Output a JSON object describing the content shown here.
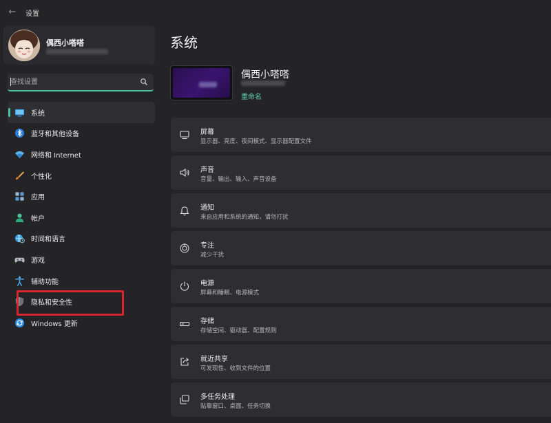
{
  "window": {
    "title": "设置",
    "back_glyph": "←"
  },
  "profile": {
    "name": "偶西小嗒嗒"
  },
  "search": {
    "placeholder": "查找设置"
  },
  "sidebar": {
    "items": [
      {
        "label": "系统",
        "icon": "monitor-icon",
        "active": true
      },
      {
        "label": "蓝牙和其他设备",
        "icon": "bluetooth-icon"
      },
      {
        "label": "网络和 Internet",
        "icon": "wifi-icon"
      },
      {
        "label": "个性化",
        "icon": "brush-icon"
      },
      {
        "label": "应用",
        "icon": "apps-icon"
      },
      {
        "label": "帐户",
        "icon": "account-icon"
      },
      {
        "label": "时间和语言",
        "icon": "globe-clock-icon"
      },
      {
        "label": "游戏",
        "icon": "gamepad-icon"
      },
      {
        "label": "辅助功能",
        "icon": "accessibility-icon"
      },
      {
        "label": "隐私和安全性",
        "icon": "shield-icon"
      },
      {
        "label": "Windows 更新",
        "icon": "update-icon"
      }
    ]
  },
  "main": {
    "title": "系统",
    "device": {
      "name": "偶西小嗒嗒",
      "rename_label": "重命名"
    },
    "cards": [
      {
        "title": "屏幕",
        "desc": "显示器、亮度、夜间模式、显示器配置文件",
        "icon": "display-icon"
      },
      {
        "title": "声音",
        "desc": "音量、输出、输入、声音设备",
        "icon": "speaker-icon"
      },
      {
        "title": "通知",
        "desc": "来自应用和系统的通知，请勿打扰",
        "icon": "bell-icon"
      },
      {
        "title": "专注",
        "desc": "减少干扰",
        "icon": "focus-icon"
      },
      {
        "title": "电源",
        "desc": "屏幕和睡眠、电源模式",
        "icon": "power-icon"
      },
      {
        "title": "存储",
        "desc": "存储空间、驱动器、配置规则",
        "icon": "storage-icon"
      },
      {
        "title": "就近共享",
        "desc": "可发现性、收到文件的位置",
        "icon": "share-icon"
      },
      {
        "title": "多任务处理",
        "desc": "贴靠窗口、桌面、任务切换",
        "icon": "multitask-icon"
      }
    ]
  },
  "colors": {
    "accent": "#47c2a2",
    "highlight_box": "#d8262e",
    "background": "#242326"
  }
}
